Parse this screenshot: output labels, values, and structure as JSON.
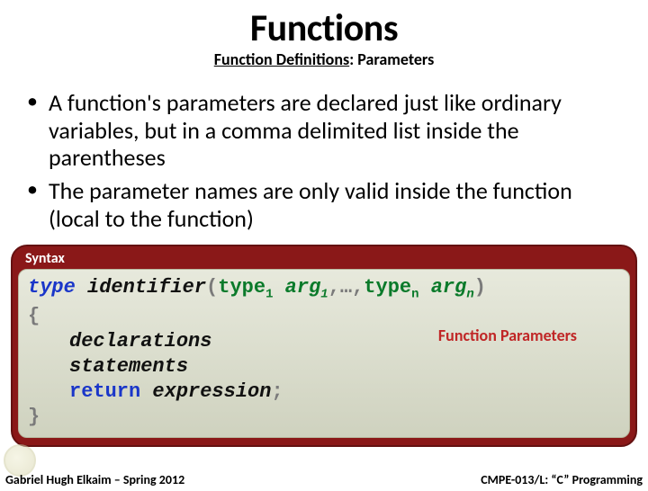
{
  "title": "Functions",
  "subtitle_a": "Function Definitions",
  "subtitle_sep": ": ",
  "subtitle_b": "Parameters",
  "bullets": [
    "A function's parameters are declared just like ordinary variables, but in a comma delimited list inside the parentheses",
    "The parameter names are only valid inside the function (local to the function)"
  ],
  "syntax": {
    "header": "Syntax",
    "type_kw": "type",
    "identifier": "identifier",
    "paren_open": "(",
    "paren_close": ")",
    "arg_type": "type",
    "arg_name": "arg",
    "sub1": "1",
    "subn": "n",
    "ellipsis": ",…,",
    "brace_open": "{",
    "brace_close": "}",
    "declarations": "declarations",
    "statements": "statements",
    "return_kw": "return",
    "expression": "expression",
    "semicolon": ";",
    "annotation": "Function Parameters"
  },
  "footer": {
    "left": "Gabriel Hugh Elkaim – Spring 2012",
    "right": "CMPE-013/L: “C” Programming"
  }
}
